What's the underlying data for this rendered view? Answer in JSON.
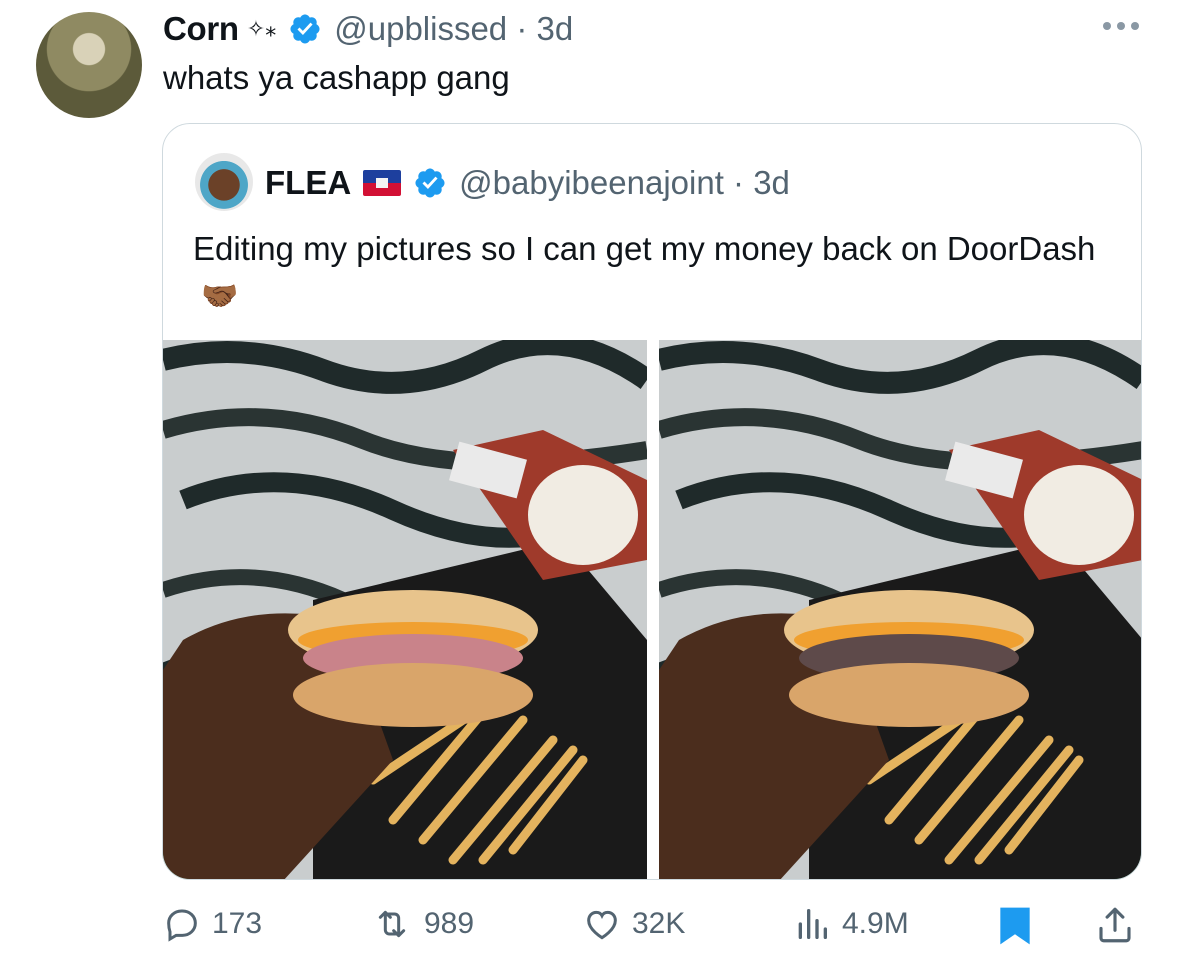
{
  "tweet": {
    "author_name": "Corn",
    "author_decoration": "✧⁎",
    "handle_time": "@upblissed · 3d",
    "text": "whats ya cashapp gang"
  },
  "quoted": {
    "author_name": "FLEA",
    "handle_time": "@babyibeenajoint · 3d",
    "text": "Editing my pictures so I can get my money back on DoorDash",
    "emoji": "🤝🏾"
  },
  "stats": {
    "replies": "173",
    "reposts": "989",
    "likes": "32K",
    "views": "4.9M"
  },
  "colors": {
    "verified": "#1d9bf0",
    "muted": "#536471",
    "bookmark": "#1d9bf0",
    "border": "#cfd9de"
  },
  "icons": [
    "verified-badge-icon",
    "more-icon",
    "haiti-flag-icon",
    "reply-icon",
    "repost-icon",
    "like-icon",
    "views-icon",
    "bookmark-icon",
    "share-icon"
  ]
}
